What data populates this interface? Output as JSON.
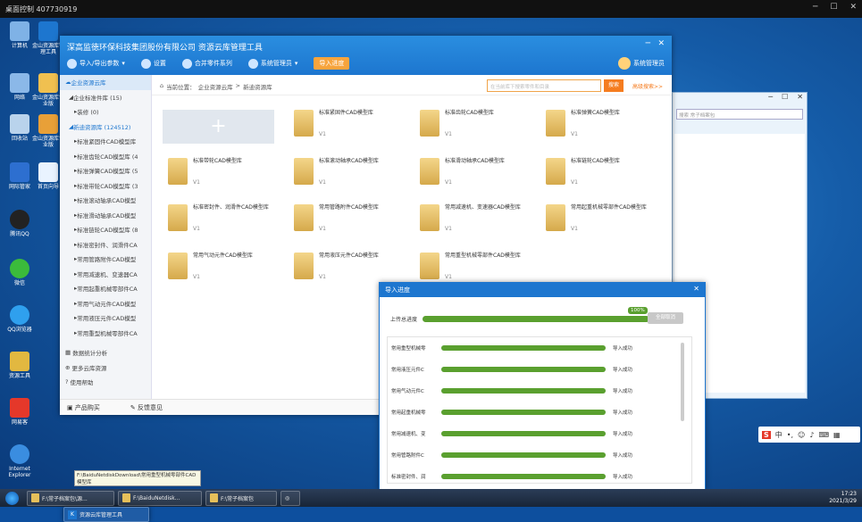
{
  "remote": {
    "title": "桌面控制 407730919"
  },
  "desktop_icons": [
    "计算机",
    "金山资源库管理工具",
    "网络",
    "金山资源库专业版",
    "回收站",
    "金山资源库专业版",
    "网际管家",
    "首页向导",
    "腾讯QQ",
    "微信",
    "QQ浏览器",
    "资源工具",
    "网易客",
    "Internet Explorer"
  ],
  "app": {
    "title": "深高监徳环保科技集团股份有限公司 资源云库管理工具",
    "toolbar": {
      "import_export": "导入/导出参数",
      "settings": "设置",
      "merge": "合并零件系列",
      "system": "系统管理员",
      "import_progress": "导入进度"
    },
    "user": "系统管理员",
    "sidebar": [
      "企业资源云库",
      "企业标准件库 (15)",
      "装修 (0)",
      "新迪资源库 (124512)",
      "标准紧固件CAD模型库",
      "标准齿轮CAD模型库 (4",
      "标准弹簧CAD模型库 (5",
      "标准带轮CAD模型库 (3",
      "标准滚动轴承CAD模型",
      "标准滑动轴承CAD模型",
      "标准链轮CAD模型库 (8",
      "标准密封件、润滑件CA",
      "常用管路附件CAD模型",
      "常用减速机、变速器CA",
      "常用起重机械零部件CA",
      "常用气动元件CAD模型",
      "常用液压元件CAD模型",
      "常用重型机械零部件CA",
      "数据统计分析",
      "更多云库资源",
      "使用帮助"
    ],
    "footer": [
      "产品购买",
      "反馈意见"
    ],
    "breadcrumb": [
      "当前位置：",
      "企业资源云库",
      ">",
      "新迪资源库"
    ],
    "search": {
      "placeholder": "在当前库下搜索零件和目录",
      "button": "搜索",
      "advanced": "高级搜索>>"
    },
    "add_tile": "+",
    "folders": [
      {
        "name": "标准紧固件CAD模型库",
        "ver": "V1"
      },
      {
        "name": "标准齿轮CAD模型库",
        "ver": "V1"
      },
      {
        "name": "标准弹簧CAD模型库",
        "ver": "V1"
      },
      {
        "name": "标准带轮CAD模型库",
        "ver": "V1"
      },
      {
        "name": "标准滚动轴承CAD模型库",
        "ver": "V1"
      },
      {
        "name": "标准滑动轴承CAD模型库",
        "ver": "V1"
      },
      {
        "name": "标准链轮CAD模型库",
        "ver": "V1"
      },
      {
        "name": "标准密封件、润滑件CAD模型库",
        "ver": "V1"
      },
      {
        "name": "常用管路附件CAD模型库",
        "ver": "V1"
      },
      {
        "name": "常用减速机、变速器CAD模型库",
        "ver": "V1"
      },
      {
        "name": "常用起重机械零部件CAD模型库",
        "ver": "V1"
      },
      {
        "name": "常用气动元件CAD模型库",
        "ver": "V1"
      },
      {
        "name": "常用液压元件CAD模型库",
        "ver": "V1"
      },
      {
        "name": "常用重型机械零部件CAD模型库",
        "ver": "V1"
      }
    ]
  },
  "explorer": {
    "search_placeholder": "搜索 常子档案包"
  },
  "dialog": {
    "title": "导入进度",
    "overall_label": "上传总进度",
    "overall_pct": "100%",
    "overall_fraction": 1.0,
    "cancel": "全部取消",
    "tasks": [
      {
        "name": "常用重型机械零",
        "status": "导入成功",
        "progress": 1.0
      },
      {
        "name": "常用液压元件C",
        "status": "导入成功",
        "progress": 1.0
      },
      {
        "name": "常用气动元件C",
        "status": "导入成功",
        "progress": 1.0
      },
      {
        "name": "常用起重机械零",
        "status": "导入成功",
        "progress": 1.0
      },
      {
        "name": "常用减速机、变",
        "status": "导入成功",
        "progress": 1.0
      },
      {
        "name": "常用管路附件C",
        "status": "导入成功",
        "progress": 1.0
      },
      {
        "name": "标准密封件、润",
        "status": "导入成功",
        "progress": 1.0
      }
    ]
  },
  "tooltip": "F:\\BaiduNetdiskDownload\\常用重型机械零部件CAD模型库",
  "ime": {
    "logo": "S",
    "lang": "中"
  },
  "taskbar": {
    "items": [
      "F:\\常子档案包\\源...",
      "F:\\BaiduNetdisk...",
      "F:\\常子档案包",
      "资源云库管理工具"
    ],
    "time": "17:23",
    "date": "2021/3/29"
  }
}
